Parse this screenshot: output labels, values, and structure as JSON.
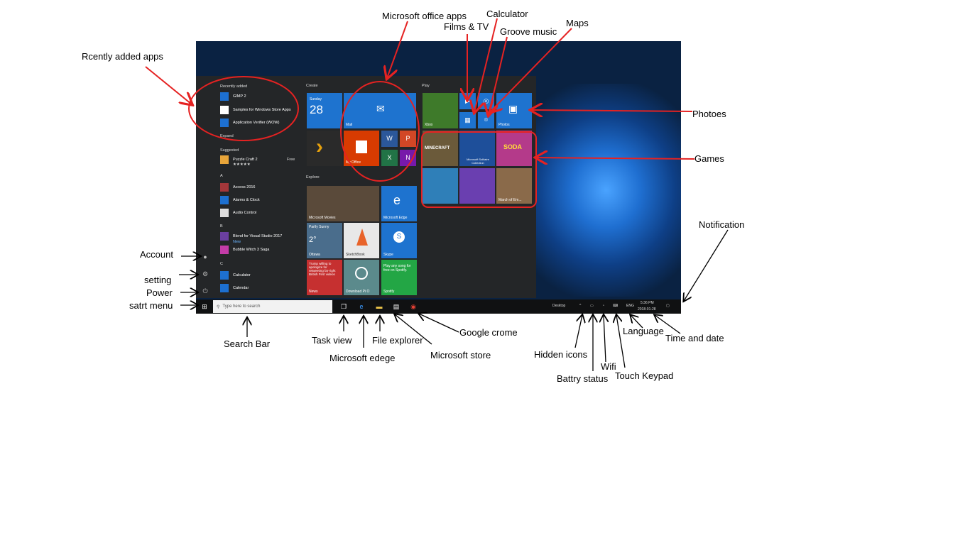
{
  "annotations": {
    "recent_apps": "Rcently added apps",
    "office_apps": "Microsoft office apps",
    "films_tv": "Films & TV",
    "calculator": "Calculator",
    "groove": "Groove music",
    "maps": "Maps",
    "photos": "Photoes",
    "games": "Games",
    "notification": "Notification",
    "account": "Account",
    "setting": "setting",
    "power": "Power",
    "start_menu": "satrt menu",
    "search_bar": "Search Bar",
    "task_view": "Task view",
    "edge": "Microsoft edege",
    "file_explorer": "File explorer",
    "store": "Microsoft store",
    "chrome": "Google crome",
    "hidden_icons": "Hidden icons",
    "battery": "Battry status",
    "wifi": "Wifi",
    "touch_keypad": "Touch Keypad",
    "language": "Language",
    "time_date": "Time and date"
  },
  "start_menu": {
    "recently_added_heading": "Recently added",
    "recent_items": [
      "GIMP 2",
      "Samples for Windows Store Apps",
      "Application Verifier (WOW)"
    ],
    "expand": "Expand",
    "suggested_heading": "Suggested",
    "suggested_item": "Puzzle Craft 2",
    "suggested_stars": "★★★★★",
    "suggested_price": "Free",
    "a_heading": "A",
    "a_items": [
      "Access 2016",
      "Alarms & Clock",
      "Audio Control"
    ],
    "b_heading": "B",
    "b_items": [
      "Blend for Visual Studio 2017",
      "Bubble Witch 3 Saga"
    ],
    "b_new": "New",
    "c_heading": "C",
    "c_items": [
      "Calculator",
      "Calendar"
    ]
  },
  "tiles": {
    "create_heading": "Create",
    "explore_heading": "Explore",
    "play_heading": "Play",
    "calendar_day": "Sunday",
    "calendar_date": "28",
    "mail": "Mail",
    "office": "My Office",
    "xbox": "Xbox",
    "photos": "Photos",
    "minecraft": "MINECRAFT",
    "solitaire": "Microsoft Solitaire Collection",
    "candy": "SODA",
    "movies": "Microsoft Movies",
    "edge": "Microsoft Edge",
    "weather_desc": "Partly Sunny",
    "weather_temp": "2°",
    "weather_city": "Ottawa",
    "sketch": "SketchBook",
    "skype": "Skype",
    "news": "News",
    "news_text": "Trump willing to apologize for retweeting far-right British First videos",
    "download": "Download Pi O",
    "spotify": "Spotify",
    "spotify_text": "Play any song for free on Spotify.",
    "march": "March of Em..."
  },
  "taskbar": {
    "search_placeholder": "Type here to search",
    "desktop": "Desktop",
    "lang": "ENG",
    "time": "5:36 PM",
    "date": "2018-01-28"
  }
}
